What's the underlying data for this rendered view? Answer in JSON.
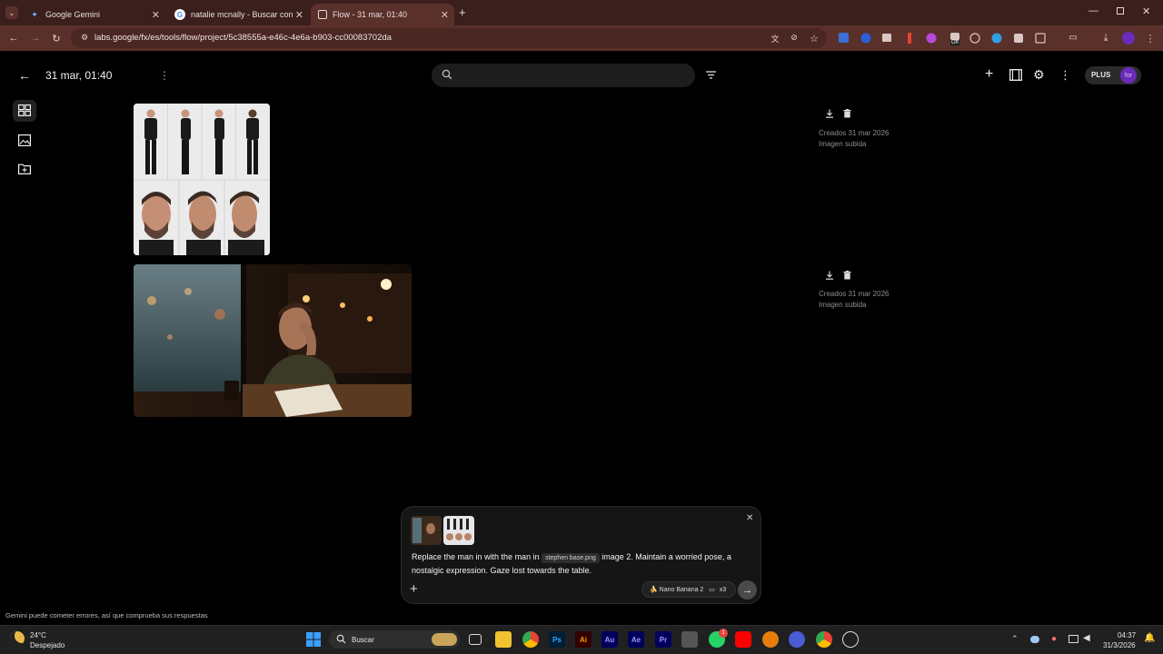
{
  "browser": {
    "tabs": [
      {
        "title": "Google Gemini",
        "icon": "gemini-icon"
      },
      {
        "title": "natalie mcnally - Buscar con Go",
        "icon": "google-icon"
      },
      {
        "title": "Flow - 31 mar, 01:40",
        "icon": "flow-icon"
      }
    ],
    "url": "labs.google/fx/es/tools/flow/project/5c38555a-e46c-4e6a-b903-cc00083702da",
    "ext_off_badge": "Off"
  },
  "app": {
    "project_title": "31 mar, 01:40",
    "plus_label": "PLUS",
    "avatar_text": "for"
  },
  "assets": [
    {
      "created": "Creados 31 mar 2026",
      "type": "Imagen subida"
    },
    {
      "created": "Creados 31 mar 2026",
      "type": "Imagen subida"
    }
  ],
  "prompt": {
    "text_before": "Replace the man in  with the man in ",
    "chip": "stephen base.png",
    "text_after": " image 2. Maintain a worried pose, a nostalgic expression. Gaze lost towards the table.",
    "model_label": "Nano Banana 2",
    "count_label": "x3"
  },
  "disclaimer": "Gemini puede cometer errores, así que comprueba sus respuestas",
  "taskbar": {
    "weather_temp": "24°C",
    "weather_desc": "Despejado",
    "search_placeholder": "Buscar",
    "time": "04:37",
    "date": "31/3/2026",
    "whatsapp_badge": "1"
  },
  "colors": {
    "tabstrip": "#3a1f1c",
    "toolbar": "#5a302b",
    "app_bg": "#000000",
    "accent_purple": "#6a2bb8"
  }
}
